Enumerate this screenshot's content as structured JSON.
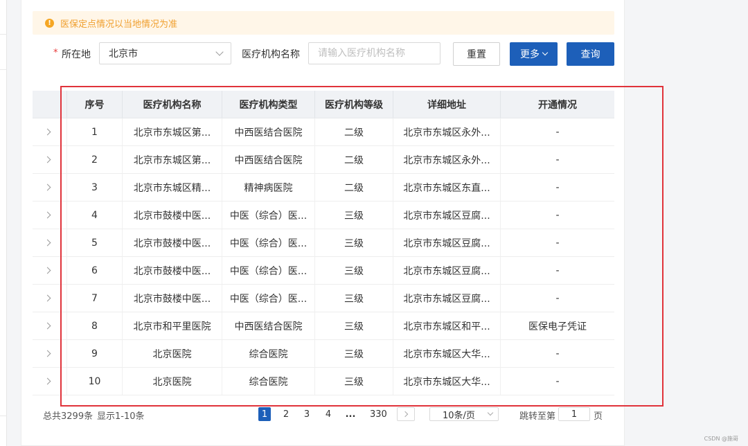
{
  "notice": {
    "text": "医保定点情况以当地情况为准"
  },
  "filters": {
    "location_label": "所在地",
    "required_mark": "*",
    "location_value": "北京市",
    "name_label": "医疗机构名称",
    "name_placeholder": "请输入医疗机构名称",
    "reset_label": "重置",
    "more_label": "更多",
    "query_label": "查询"
  },
  "table": {
    "headers": [
      "序号",
      "医疗机构名称",
      "医疗机构类型",
      "医疗机构等级",
      "详细地址",
      "开通情况"
    ],
    "rows": [
      [
        "1",
        "北京市东城区第...",
        "中西医结合医院",
        "二级",
        "北京市东城区永外...",
        "-"
      ],
      [
        "2",
        "北京市东城区第...",
        "中西医结合医院",
        "二级",
        "北京市东城区永外...",
        "-"
      ],
      [
        "3",
        "北京市东城区精...",
        "精神病医院",
        "二级",
        "北京市东城区东直...",
        "-"
      ],
      [
        "4",
        "北京市鼓楼中医...",
        "中医（综合）医...",
        "三级",
        "北京市东城区豆腐...",
        "-"
      ],
      [
        "5",
        "北京市鼓楼中医...",
        "中医（综合）医...",
        "三级",
        "北京市东城区豆腐...",
        "-"
      ],
      [
        "6",
        "北京市鼓楼中医...",
        "中医（综合）医...",
        "三级",
        "北京市东城区豆腐...",
        "-"
      ],
      [
        "7",
        "北京市鼓楼中医...",
        "中医（综合）医...",
        "三级",
        "北京市东城区豆腐...",
        "-"
      ],
      [
        "8",
        "北京市和平里医院",
        "中西医结合医院",
        "三级",
        "北京市东城区和平...",
        "医保电子凭证"
      ],
      [
        "9",
        "北京医院",
        "综合医院",
        "三级",
        "北京市东城区大华...",
        "-"
      ],
      [
        "10",
        "北京医院",
        "综合医院",
        "三级",
        "北京市东城区大华...",
        "-"
      ]
    ]
  },
  "pagination": {
    "total": "总共3299条",
    "range": "显示1-10条",
    "pages": [
      "1",
      "2",
      "3",
      "4"
    ],
    "ellipsis": "...",
    "last_page": "330",
    "page_size": "10条/页",
    "jump_prefix": "跳转至第",
    "jump_value": "1",
    "jump_suffix": "页"
  },
  "watermark": "CSDN @施哥",
  "colors": {
    "primary": "#1d5fb9",
    "warning": "#f5a623",
    "highlight_frame": "#e0323a"
  }
}
